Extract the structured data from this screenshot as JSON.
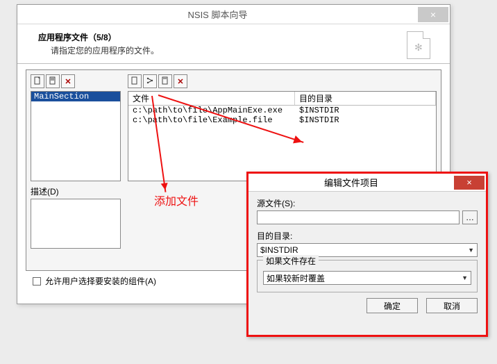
{
  "window": {
    "title": "NSIS 脚本向导",
    "heading": "应用程序文件（5/8）",
    "subheading": "请指定您的应用程序的文件。"
  },
  "left_toolbar": [
    "new",
    "edit",
    "delete"
  ],
  "right_toolbar": [
    "new",
    "tree",
    "edit",
    "delete"
  ],
  "sections": {
    "items": [
      "MainSection"
    ]
  },
  "desc_label": "描述(D)",
  "file_table": {
    "col_file": "文件",
    "col_dir": "目的目录",
    "rows": [
      {
        "file": "c:\\path\\to\\file\\AppMainExe.exe",
        "dir": "$INSTDIR"
      },
      {
        "file": "c:\\path\\to\\file\\Example.file",
        "dir": "$INSTDIR"
      }
    ]
  },
  "chk_label": "允许用户选择要安装的组件(A)",
  "dialog": {
    "title": "编辑文件项目",
    "src_label": "源文件(S):",
    "src_value": "",
    "dest_label": "目的目录:",
    "dest_value": "$INSTDIR",
    "exists_legend": "如果文件存在",
    "exists_value": "如果较新时覆盖",
    "ok": "确定",
    "cancel": "取消"
  },
  "annotation": "添加文件"
}
